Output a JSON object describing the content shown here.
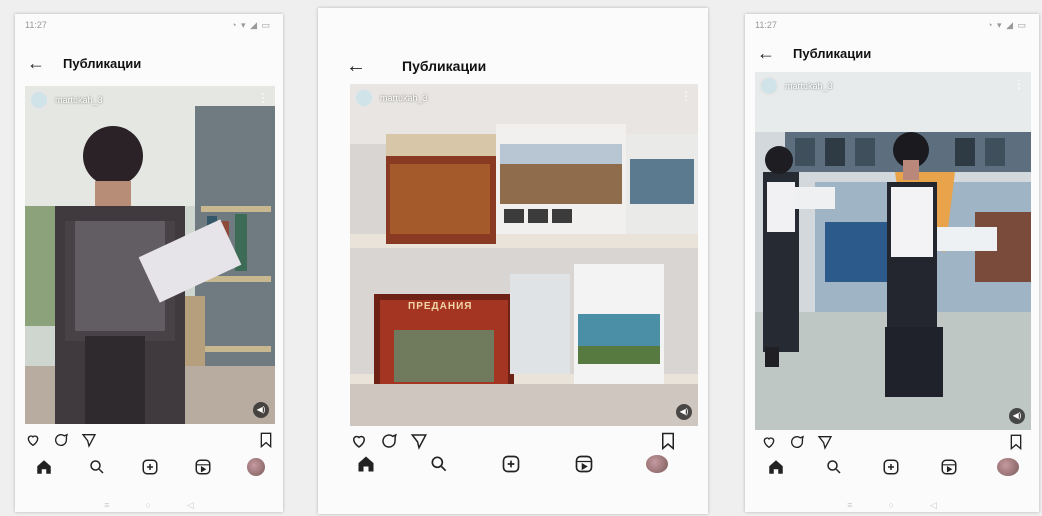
{
  "phones": [
    {
      "status_time": "11:27",
      "status_icons": "◔ ▾ ◢ ▭",
      "header_title": "Публикации",
      "username": "martukah_3"
    },
    {
      "header_title": "Публикации",
      "username": "martukah_3",
      "book_title": "ПРЕДАНИЯ"
    },
    {
      "status_time": "11:27",
      "status_icons": "◔ ▾ ◢ ▭",
      "header_title": "Публикации",
      "username": "martukah_3"
    }
  ],
  "icons": {
    "back": "back-arrow-icon",
    "like": "heart-icon",
    "comment": "comment-icon",
    "share": "send-icon",
    "save": "bookmark-icon",
    "home": "home-icon",
    "search": "search-icon",
    "new_post": "add-post-icon",
    "reels": "reels-icon",
    "profile": "profile-avatar"
  }
}
